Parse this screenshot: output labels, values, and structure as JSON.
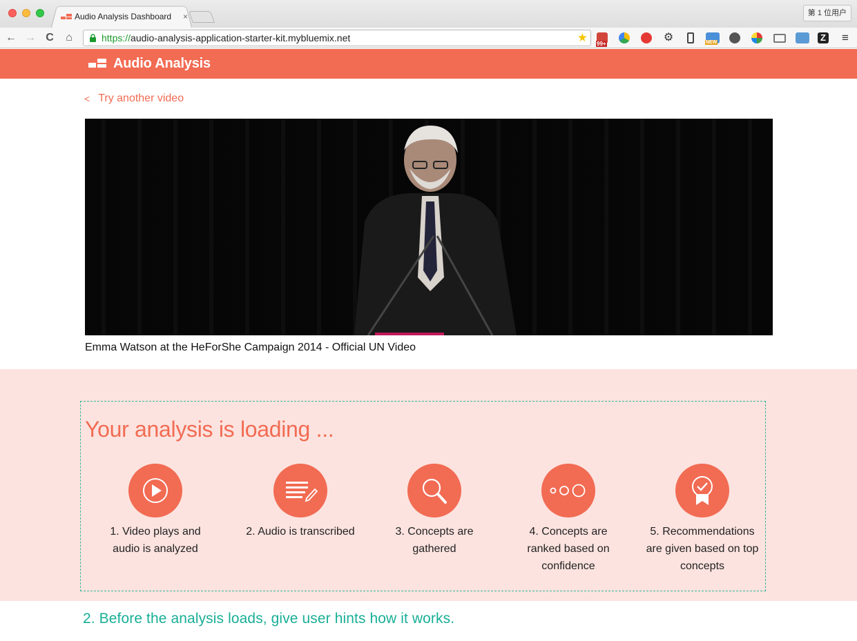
{
  "browser": {
    "tab_title": "Audio Analysis Dashboard",
    "tab_close": "×",
    "user_button": "第 1 位用户",
    "url_scheme": "https://",
    "url_rest": "audio-analysis-application-starter-kit.mybluemix.net",
    "nav": {
      "back": "←",
      "forward": "→",
      "reload": "C",
      "home": "⌂"
    },
    "extension_badges": {
      "badge_99": "99+",
      "badge_new": "NEW",
      "badge_z": "Z"
    }
  },
  "app": {
    "title": "Audio Analysis",
    "back_link": "Try another video",
    "back_chevron": "<",
    "video_caption": "Emma Watson at the HeForShe Campaign 2014 - Official UN Video"
  },
  "loading": {
    "title": "Your analysis is loading ...",
    "steps": [
      {
        "icon": "play-icon",
        "line1": "1. Video plays and",
        "line2": "audio is analyzed",
        "line3": ""
      },
      {
        "icon": "transcribe-icon",
        "line1": "2. Audio is transcribed",
        "line2": "",
        "line3": ""
      },
      {
        "icon": "search-icon",
        "line1": "3. Concepts are",
        "line2": "gathered",
        "line3": ""
      },
      {
        "icon": "ranking-dots-icon",
        "line1": "4. Concepts are",
        "line2": "ranked based on",
        "line3": "confidence"
      },
      {
        "icon": "award-ribbon-icon",
        "line1": "5. Recommendations",
        "line2": "are given based on top",
        "line3": "concepts"
      }
    ]
  },
  "annotation": "2. Before the analysis loads, give user hints how it works.",
  "colors": {
    "brand": "#f26b53",
    "loading_background": "#fce3df",
    "annotation": "#19ae96"
  }
}
